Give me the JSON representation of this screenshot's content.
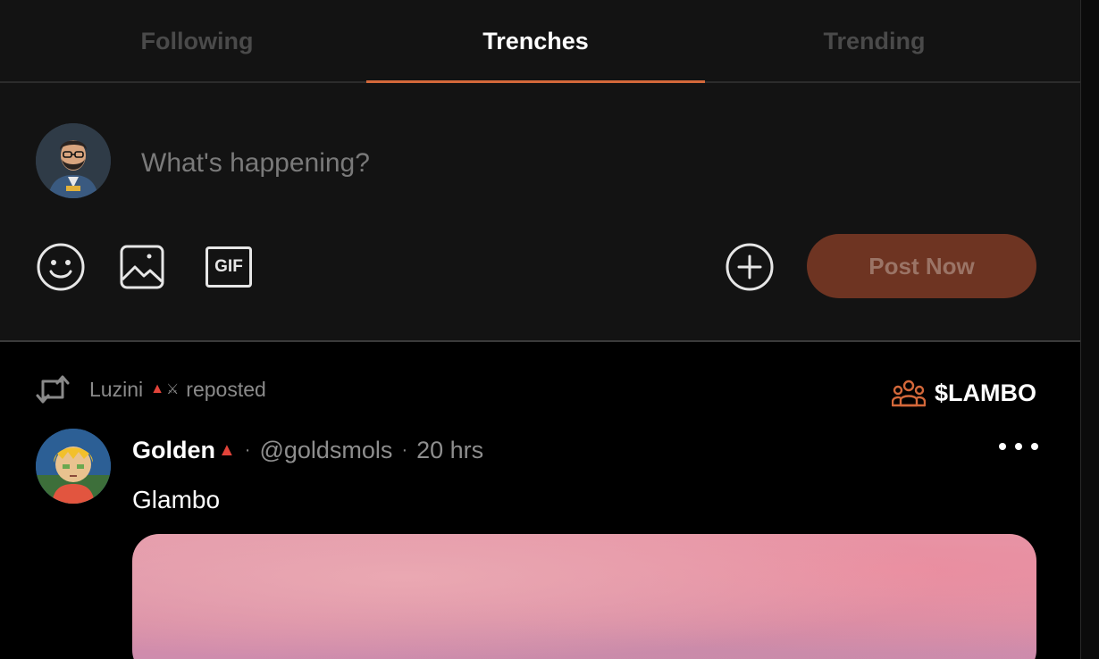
{
  "tabs": [
    {
      "label": "Following",
      "active": false
    },
    {
      "label": "Trenches",
      "active": true
    },
    {
      "label": "Trending",
      "active": false
    }
  ],
  "composer": {
    "placeholder": "What's happening?",
    "tools": {
      "emoji": "smile-icon",
      "image": "image-icon",
      "gif_label": "GIF",
      "add": "plus-circle-icon"
    },
    "post_button_label": "Post Now"
  },
  "feed": {
    "repost": {
      "user": "Luzini",
      "badge": "▲",
      "badge_extra": "⚔",
      "label": "reposted"
    },
    "community": {
      "icon": "community-icon",
      "label": "$LAMBO"
    },
    "post": {
      "name": "Golden",
      "badge": "▲",
      "separator": "·",
      "handle": "@goldsmols",
      "time": "20 hrs",
      "body": "Glambo"
    }
  },
  "colors": {
    "accent": "#d4683a",
    "post_button_bg": "#6e3422",
    "post_button_text": "#9b7466",
    "background": "#000000",
    "panel": "#131313"
  }
}
